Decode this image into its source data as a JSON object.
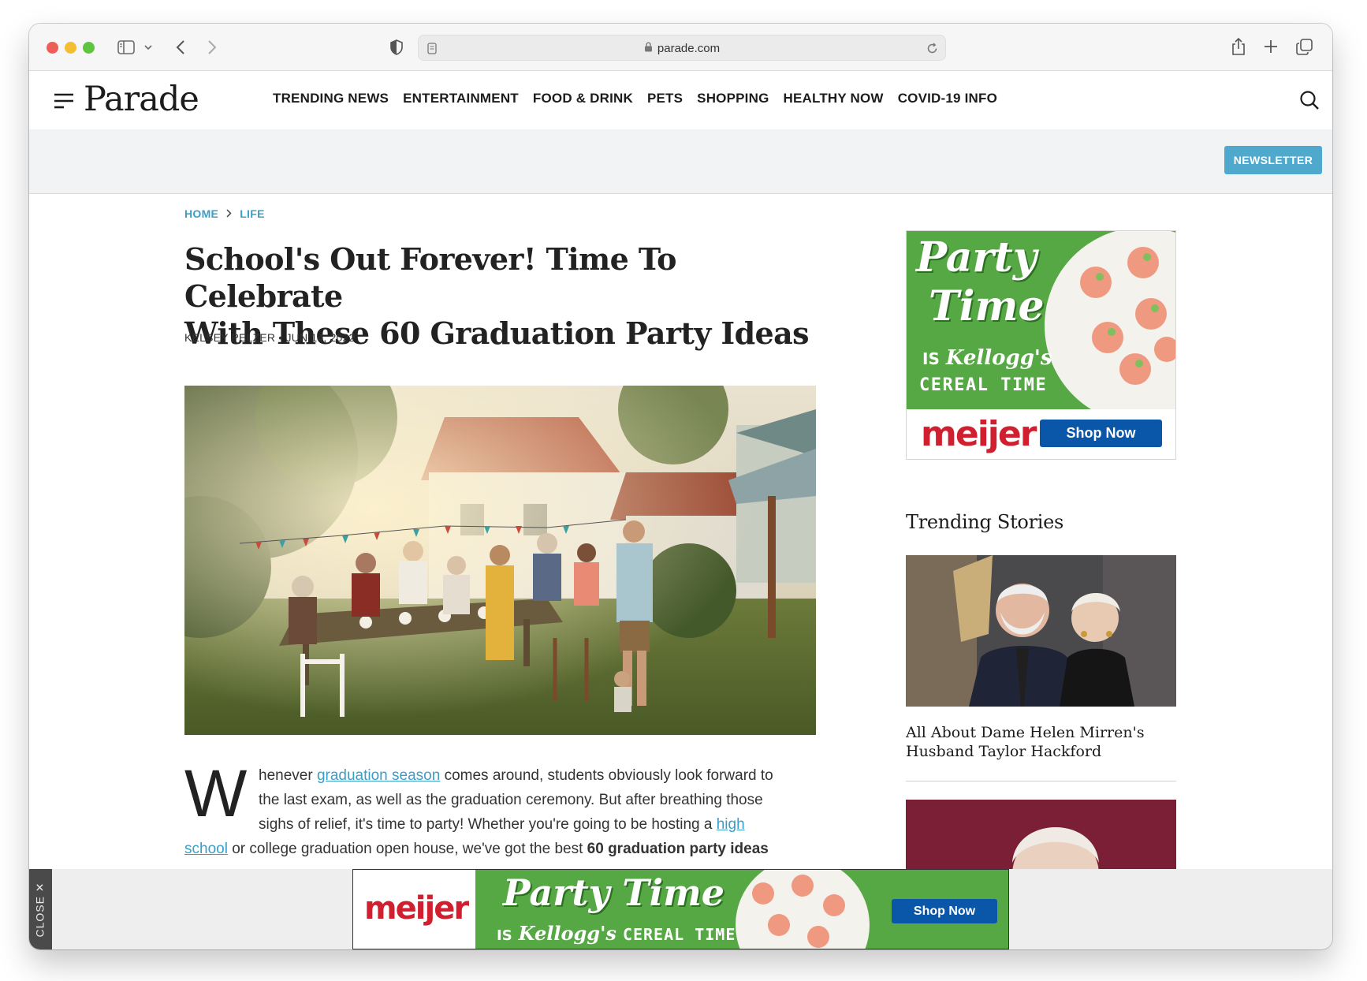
{
  "browser": {
    "url": "parade.com",
    "lock_icon": "lock-icon",
    "reload_icon": "reload-icon"
  },
  "site": {
    "logo": "Parade",
    "nav": [
      "TRENDING NEWS",
      "ENTERTAINMENT",
      "FOOD & DRINK",
      "PETS",
      "SHOPPING",
      "HEALTHY NOW",
      "COVID-19 INFO"
    ],
    "newsletter": "NEWSLETTER"
  },
  "article": {
    "breadcrumb": [
      "HOME",
      "LIFE"
    ],
    "headline_line1": "School's Out Forever! Time To Celebrate",
    "headline_line2": "With These 60 Graduation Party Ideas",
    "author": "KELSEY PELZER",
    "date": "JUN 14, 2022",
    "body": {
      "dropcap": "W",
      "l1_a": "henever ",
      "l1_link": "graduation season",
      "l1_b": " comes around, students obviously look forward to",
      "l2": "the last exam, as well as the graduation ceremony. But after breathing those",
      "l3_a": "sighs of relief, it's time to party! Whether you're going to be hosting a ",
      "l3_link": "high",
      "l4_link": "school",
      "l4_b": " or college graduation open house, we've got the best ",
      "l4_bold": "60 graduation party ideas"
    }
  },
  "sidebar_ad": {
    "line1": "Party",
    "line2": "Time",
    "line3_is": "IS",
    "line3_brand": "Kellogg's",
    "line4": "CEREAL TIME",
    "store": "meijer",
    "cta": "Shop Now"
  },
  "trending": {
    "title": "Trending Stories",
    "stories": [
      {
        "title_line1": "All About Dame Helen Mirren's",
        "title_line2": "Husband Taylor Hackford"
      }
    ]
  },
  "bottom_ad": {
    "store": "meijer",
    "headline": "Party Time",
    "is": "IS",
    "brand": "Kellogg's",
    "tag": "CEREAL TIME",
    "cta": "Shop Now",
    "close": "CLOSE"
  },
  "colors": {
    "accent": "#4ea9cc",
    "ad_green": "#56a844",
    "meijer_red": "#d0202f",
    "meijer_blue": "#0a56a8"
  }
}
